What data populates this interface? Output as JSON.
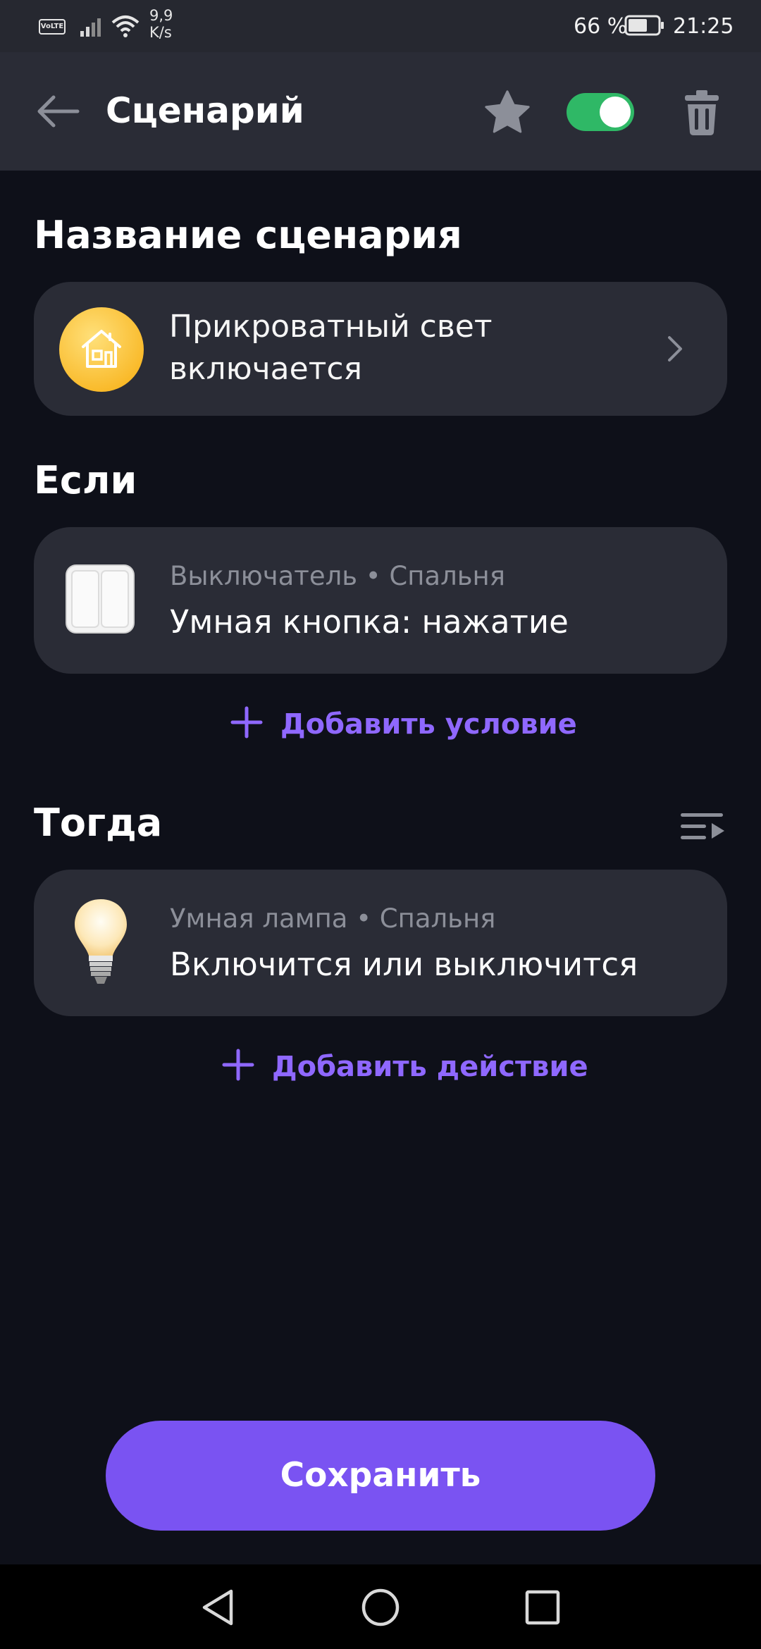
{
  "status_bar": {
    "volte": "VoLTE",
    "speed_value": "9,9",
    "speed_unit": "K/s",
    "battery_text": "66 %",
    "battery_level": 0.66,
    "time": "21:25"
  },
  "app_bar": {
    "title": "Сценарий",
    "enabled": true
  },
  "sections": {
    "name_title": "Название сценария",
    "if_title": "Если",
    "then_title": "Тогда"
  },
  "scenario": {
    "name": "Прикроватный свет включается",
    "icon": "house-icon"
  },
  "condition": {
    "subtitle": "Выключатель • Спальня",
    "title": "Умная кнопка: нажатие",
    "icon": "switch-icon"
  },
  "add_condition_label": "Добавить условие",
  "action": {
    "subtitle": "Умная лампа • Спальня",
    "title": "Включится или выключится",
    "icon": "bulb-icon"
  },
  "add_action_label": "Добавить действие",
  "save_label": "Сохранить",
  "colors": {
    "accent": "#7a53f2",
    "toggle_on": "#2fb866",
    "background": "#0e1019",
    "card": "#2a2c36"
  }
}
